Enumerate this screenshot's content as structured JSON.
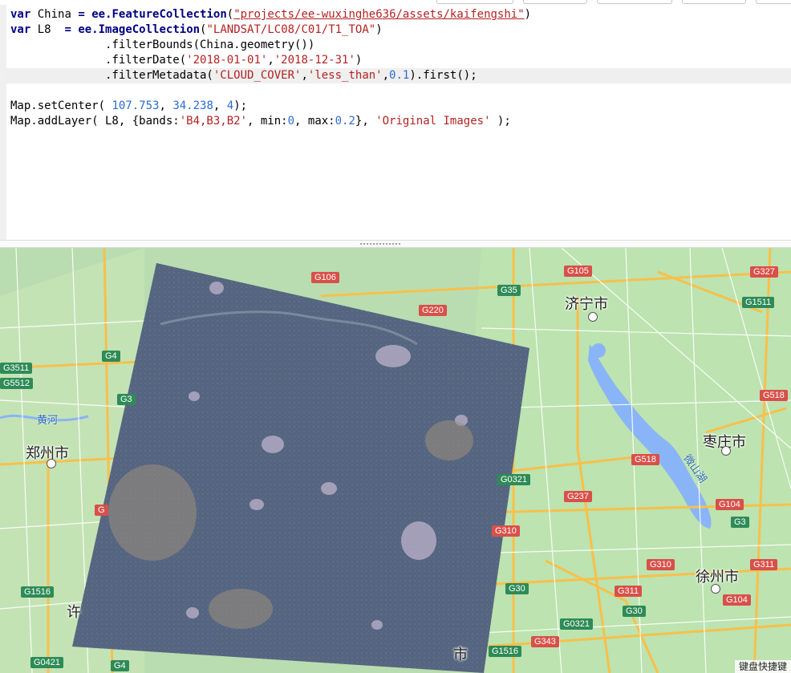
{
  "editor": {
    "lines": [
      {
        "id": "l1",
        "segments": [
          [
            "kw",
            "var"
          ],
          [
            "fn",
            " China "
          ],
          [
            "kw",
            "="
          ],
          [
            "fn",
            " "
          ],
          [
            "kw",
            "ee.FeatureCollection"
          ],
          [
            "fn",
            "("
          ],
          [
            "link-str",
            "\"projects/ee-wuxinghe636/assets/kaifengshi\""
          ],
          [
            "fn",
            ")"
          ]
        ]
      },
      {
        "id": "l2",
        "segments": [
          [
            "kw",
            "var"
          ],
          [
            "fn",
            " L8  "
          ],
          [
            "kw",
            "="
          ],
          [
            "fn",
            " "
          ],
          [
            "kw",
            "ee.ImageCollection"
          ],
          [
            "fn",
            "("
          ],
          [
            "str",
            "\"LANDSAT/LC08/C01/T1_TOA\""
          ],
          [
            "fn",
            ")"
          ]
        ]
      },
      {
        "id": "l3",
        "segments": [
          [
            "fn",
            "              .filterBounds(China.geometry())"
          ]
        ]
      },
      {
        "id": "l4",
        "segments": [
          [
            "fn",
            "              .filterDate("
          ],
          [
            "str",
            "'2018-01-01'"
          ],
          [
            "fn",
            ","
          ],
          [
            "str",
            "'2018-12-31'"
          ],
          [
            "fn",
            ")"
          ]
        ]
      },
      {
        "id": "l5",
        "segments": [
          [
            "fn",
            "              .filterMetadata("
          ],
          [
            "str",
            "'CLOUD_COVER'"
          ],
          [
            "fn",
            ","
          ],
          [
            "str",
            "'less_than'"
          ],
          [
            "fn",
            ","
          ],
          [
            "num",
            "0.1"
          ],
          [
            "fn",
            ").first();"
          ]
        ]
      },
      {
        "id": "l6",
        "segments": []
      },
      {
        "id": "l7",
        "segments": [
          [
            "fn",
            "Map.setCenter( "
          ],
          [
            "num",
            "107.753"
          ],
          [
            "fn",
            ", "
          ],
          [
            "num",
            "34.238"
          ],
          [
            "fn",
            ", "
          ],
          [
            "num",
            "4"
          ],
          [
            "fn",
            ");"
          ]
        ]
      },
      {
        "id": "l8",
        "segments": [
          [
            "fn",
            "Map.addLayer( L8, {bands:"
          ],
          [
            "str",
            "'B4,B3,B2'"
          ],
          [
            "fn",
            ", min:"
          ],
          [
            "num",
            "0"
          ],
          [
            "fn",
            ", max:"
          ],
          [
            "num",
            "0.2"
          ],
          [
            "fn",
            "}, "
          ],
          [
            "str",
            "'Original Images'"
          ],
          [
            "fn",
            " );"
          ]
        ]
      }
    ]
  },
  "map": {
    "cities": [
      {
        "name": "济宁市",
        "key": "jining"
      },
      {
        "name": "枣庄市",
        "key": "zaozhuang"
      },
      {
        "name": "郑州市",
        "key": "zhengzhou"
      },
      {
        "name": "徐州市",
        "key": "xuzhou"
      },
      {
        "name": "许",
        "key": "xu"
      },
      {
        "name": "市",
        "key": "shi"
      }
    ],
    "water_labels": {
      "yellow_river": "黄河",
      "weishan_lake": "微山湖"
    },
    "shields": [
      {
        "label": "G106",
        "style": "sh-g"
      },
      {
        "label": "G105",
        "style": "sh-g"
      },
      {
        "label": "G327",
        "style": "sh-g"
      },
      {
        "label": "G35",
        "style": "sh-grn"
      },
      {
        "label": "G220",
        "style": "sh-g"
      },
      {
        "label": "G1511",
        "style": "sh-grn"
      },
      {
        "label": "G4",
        "style": "sh-grn"
      },
      {
        "label": "G3511",
        "style": "sh-grn"
      },
      {
        "label": "G5512",
        "style": "sh-grn"
      },
      {
        "label": "G518",
        "style": "sh-g"
      },
      {
        "label": "G518",
        "style": "sh-g"
      },
      {
        "label": "G0321",
        "style": "sh-grn"
      },
      {
        "label": "G237",
        "style": "sh-g"
      },
      {
        "label": "G310",
        "style": "sh-g"
      },
      {
        "label": "G104",
        "style": "sh-g"
      },
      {
        "label": "G3",
        "style": "sh-grn"
      },
      {
        "label": "G310",
        "style": "sh-g"
      },
      {
        "label": "G311",
        "style": "sh-g"
      },
      {
        "label": "G1516",
        "style": "sh-grn"
      },
      {
        "label": "G30",
        "style": "sh-grn"
      },
      {
        "label": "G311",
        "style": "sh-g"
      },
      {
        "label": "G104",
        "style": "sh-g"
      },
      {
        "label": "G30",
        "style": "sh-grn"
      },
      {
        "label": "G0321",
        "style": "sh-grn"
      },
      {
        "label": "G343",
        "style": "sh-g"
      },
      {
        "label": "G1516",
        "style": "sh-grn"
      },
      {
        "label": "G0421",
        "style": "sh-grn"
      },
      {
        "label": "G4",
        "style": "sh-grn"
      },
      {
        "label": "G3",
        "style": "sh-grn"
      },
      {
        "label": "G",
        "style": "sh-g"
      }
    ],
    "keyboard_shortcuts": "键盘快捷键",
    "colors": {
      "land": "#b9ddb0",
      "water": "#8ab4f8",
      "road_major": "#f7c04a",
      "road_minor": "#ffffff",
      "overlay": "#5a6a85"
    }
  }
}
